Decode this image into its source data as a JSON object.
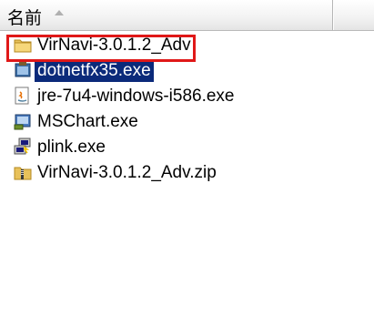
{
  "header": {
    "name_label": "名前"
  },
  "files": [
    {
      "label": "VirNavi-3.0.1.2_Adv",
      "icon": "folder-icon"
    },
    {
      "label": "dotnetfx35.exe",
      "icon": "installer-icon",
      "selected": true
    },
    {
      "label": "jre-7u4-windows-i586.exe",
      "icon": "java-icon"
    },
    {
      "label": "MSChart.exe",
      "icon": "setup-exe-icon"
    },
    {
      "label": "plink.exe",
      "icon": "putty-icon"
    },
    {
      "label": "VirNavi-3.0.1.2_Adv.zip",
      "icon": "zip-folder-icon"
    }
  ],
  "colors": {
    "selection": "#0b2a7a",
    "highlight_box": "#e01818"
  }
}
